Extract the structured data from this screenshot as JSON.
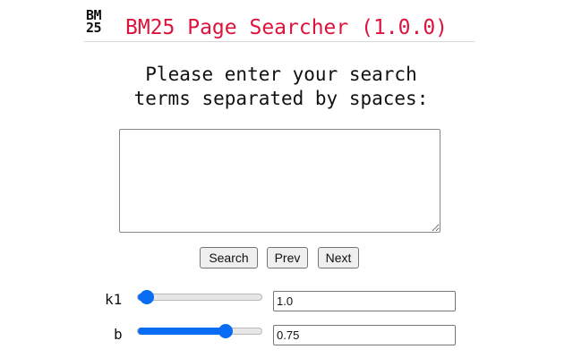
{
  "header": {
    "logo_top": "BM",
    "logo_bottom": "25",
    "title": "BM25 Page Searcher (1.0.0)",
    "title_color": "#dc143c"
  },
  "prompt": {
    "line1": "Please enter your search",
    "line2": "terms separated by spaces:"
  },
  "query": {
    "value": "",
    "placeholder": ""
  },
  "buttons": {
    "search_label": "Search",
    "prev_label": "Prev",
    "next_label": "Next"
  },
  "params": {
    "k1": {
      "label": "k1",
      "value": "1.0",
      "slider_fraction": 0.07
    },
    "b": {
      "label": "b",
      "value": "0.75",
      "slider_fraction": 0.71
    }
  },
  "accent_color": "#0a6cf2"
}
